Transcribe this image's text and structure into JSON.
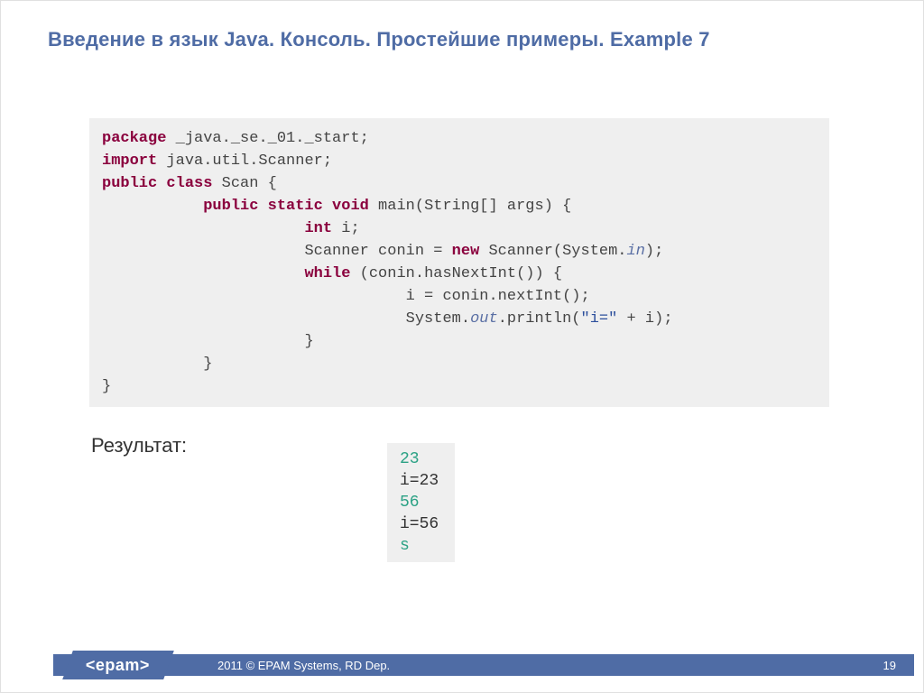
{
  "title": "Введение в язык Java. Консоль. Простейшие примеры. Example 7",
  "code": {
    "l1_kw": "package",
    "l1_rest": " _java._se._01._start;",
    "l2_kw": "import",
    "l2_rest": " java.util.Scanner;",
    "l3_kw": "public class",
    "l3_rest": " Scan {",
    "l4_pad": "           ",
    "l4_kw": "public static void",
    "l4_rest": " main(String[] args) {",
    "l5_pad": "                      ",
    "l5_kw": "int",
    "l5_rest": " i;",
    "l6_pad": "                      ",
    "l6_a": "Scanner conin = ",
    "l6_kw": "new",
    "l6_b": " Scanner(System.",
    "l6_in": "in",
    "l6_c": ");",
    "l7_pad": "                      ",
    "l7_kw": "while",
    "l7_rest": " (conin.hasNextInt()) {",
    "l8_pad": "                                 ",
    "l8_rest": "i = conin.nextInt();",
    "l9_pad": "                                 ",
    "l9_a": "System.",
    "l9_out": "out",
    "l9_b": ".println(",
    "l9_str": "\"i=\"",
    "l9_c": " + i);",
    "l10_pad": "                      ",
    "l10_rest": "}",
    "l11_pad": "           ",
    "l11_rest": "}",
    "l12_rest": "}"
  },
  "result_label": "Результат:",
  "result": {
    "r1": "23",
    "r2": "i=23",
    "r3": "56",
    "r4": "i=56",
    "r5": "s"
  },
  "footer": {
    "logo": "<epam>",
    "copyright": "2011 © EPAM Systems, RD Dep.",
    "page": "19"
  }
}
